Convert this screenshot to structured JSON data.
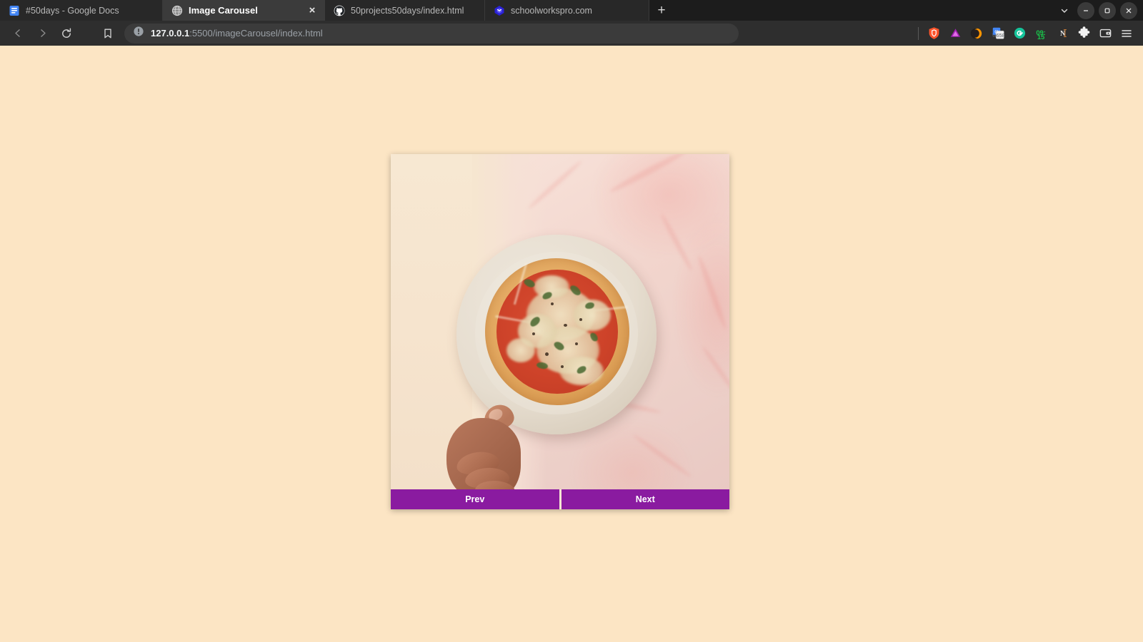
{
  "window": {
    "controls": {
      "tab_search_label": "⌄",
      "minimize_label": "–",
      "maximize_label": "□",
      "close_label": "×"
    }
  },
  "tabs": [
    {
      "title": "#50days - Google Docs",
      "favicon": "google-docs-icon",
      "active": false
    },
    {
      "title": "Image Carousel",
      "favicon": "globe-icon",
      "active": true,
      "close_label": "×"
    },
    {
      "title": "50projects50days/index.html",
      "favicon": "github-icon",
      "active": false
    },
    {
      "title": "schoolworkspro.com",
      "favicon": "schoolworkspro-icon",
      "active": false
    }
  ],
  "newtab": {
    "label": "+"
  },
  "toolbar": {
    "back_label": "◁",
    "forward_label": "▷",
    "reload_label": "↻",
    "bookmark_label": "☐",
    "security_icon": "not-secure-info-icon",
    "url_host": "127.0.0.1",
    "url_path": ":5500/imageCarousel/index.html",
    "url_full": "127.0.0.1:5500/imageCarousel/index.html",
    "extensions": [
      {
        "name": "brave-shields-icon",
        "label": ""
      },
      {
        "name": "brave-rewards-icon",
        "label": ""
      },
      {
        "name": "dark-reader-icon",
        "label": ""
      },
      {
        "name": "google-translate-icon",
        "label": ""
      },
      {
        "name": "grammarly-icon",
        "label": "G"
      },
      {
        "name": "timer-badge-icon",
        "label": "09:\n15",
        "timer_top": "09:",
        "timer_bottom": "15",
        "color": "#19c34a"
      },
      {
        "name": "notion-web-clipper-icon",
        "label": "N"
      },
      {
        "name": "extensions-puzzle-icon",
        "label": ""
      },
      {
        "name": "wallet-icon",
        "label": ""
      },
      {
        "name": "browser-menu-icon",
        "label": "≡"
      }
    ]
  },
  "page": {
    "background_color": "#fce5c4",
    "carousel": {
      "image_alt": "Hand holding a plate with a cheese and basil pizza on a pink marble surface",
      "prev_label": "Prev",
      "next_label": "Next",
      "button_color": "#8a1ba0",
      "button_text_color": "#ffffff"
    }
  }
}
